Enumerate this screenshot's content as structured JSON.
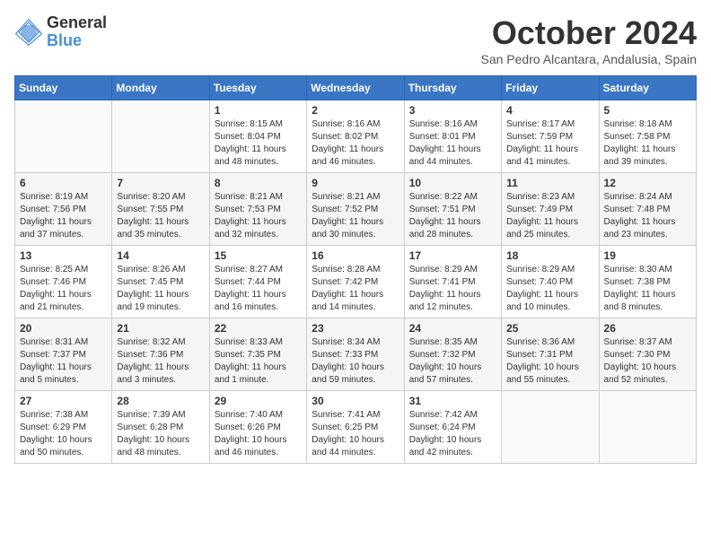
{
  "logo": {
    "general": "General",
    "blue": "Blue"
  },
  "header": {
    "month": "October 2024",
    "location": "San Pedro Alcantara, Andalusia, Spain"
  },
  "days_of_week": [
    "Sunday",
    "Monday",
    "Tuesday",
    "Wednesday",
    "Thursday",
    "Friday",
    "Saturday"
  ],
  "weeks": [
    [
      {
        "day": "",
        "info": ""
      },
      {
        "day": "",
        "info": ""
      },
      {
        "day": "1",
        "info": "Sunrise: 8:15 AM\nSunset: 8:04 PM\nDaylight: 11 hours and 48 minutes."
      },
      {
        "day": "2",
        "info": "Sunrise: 8:16 AM\nSunset: 8:02 PM\nDaylight: 11 hours and 46 minutes."
      },
      {
        "day": "3",
        "info": "Sunrise: 8:16 AM\nSunset: 8:01 PM\nDaylight: 11 hours and 44 minutes."
      },
      {
        "day": "4",
        "info": "Sunrise: 8:17 AM\nSunset: 7:59 PM\nDaylight: 11 hours and 41 minutes."
      },
      {
        "day": "5",
        "info": "Sunrise: 8:18 AM\nSunset: 7:58 PM\nDaylight: 11 hours and 39 minutes."
      }
    ],
    [
      {
        "day": "6",
        "info": "Sunrise: 8:19 AM\nSunset: 7:56 PM\nDaylight: 11 hours and 37 minutes."
      },
      {
        "day": "7",
        "info": "Sunrise: 8:20 AM\nSunset: 7:55 PM\nDaylight: 11 hours and 35 minutes."
      },
      {
        "day": "8",
        "info": "Sunrise: 8:21 AM\nSunset: 7:53 PM\nDaylight: 11 hours and 32 minutes."
      },
      {
        "day": "9",
        "info": "Sunrise: 8:21 AM\nSunset: 7:52 PM\nDaylight: 11 hours and 30 minutes."
      },
      {
        "day": "10",
        "info": "Sunrise: 8:22 AM\nSunset: 7:51 PM\nDaylight: 11 hours and 28 minutes."
      },
      {
        "day": "11",
        "info": "Sunrise: 8:23 AM\nSunset: 7:49 PM\nDaylight: 11 hours and 25 minutes."
      },
      {
        "day": "12",
        "info": "Sunrise: 8:24 AM\nSunset: 7:48 PM\nDaylight: 11 hours and 23 minutes."
      }
    ],
    [
      {
        "day": "13",
        "info": "Sunrise: 8:25 AM\nSunset: 7:46 PM\nDaylight: 11 hours and 21 minutes."
      },
      {
        "day": "14",
        "info": "Sunrise: 8:26 AM\nSunset: 7:45 PM\nDaylight: 11 hours and 19 minutes."
      },
      {
        "day": "15",
        "info": "Sunrise: 8:27 AM\nSunset: 7:44 PM\nDaylight: 11 hours and 16 minutes."
      },
      {
        "day": "16",
        "info": "Sunrise: 8:28 AM\nSunset: 7:42 PM\nDaylight: 11 hours and 14 minutes."
      },
      {
        "day": "17",
        "info": "Sunrise: 8:29 AM\nSunset: 7:41 PM\nDaylight: 11 hours and 12 minutes."
      },
      {
        "day": "18",
        "info": "Sunrise: 8:29 AM\nSunset: 7:40 PM\nDaylight: 11 hours and 10 minutes."
      },
      {
        "day": "19",
        "info": "Sunrise: 8:30 AM\nSunset: 7:38 PM\nDaylight: 11 hours and 8 minutes."
      }
    ],
    [
      {
        "day": "20",
        "info": "Sunrise: 8:31 AM\nSunset: 7:37 PM\nDaylight: 11 hours and 5 minutes."
      },
      {
        "day": "21",
        "info": "Sunrise: 8:32 AM\nSunset: 7:36 PM\nDaylight: 11 hours and 3 minutes."
      },
      {
        "day": "22",
        "info": "Sunrise: 8:33 AM\nSunset: 7:35 PM\nDaylight: 11 hours and 1 minute."
      },
      {
        "day": "23",
        "info": "Sunrise: 8:34 AM\nSunset: 7:33 PM\nDaylight: 10 hours and 59 minutes."
      },
      {
        "day": "24",
        "info": "Sunrise: 8:35 AM\nSunset: 7:32 PM\nDaylight: 10 hours and 57 minutes."
      },
      {
        "day": "25",
        "info": "Sunrise: 8:36 AM\nSunset: 7:31 PM\nDaylight: 10 hours and 55 minutes."
      },
      {
        "day": "26",
        "info": "Sunrise: 8:37 AM\nSunset: 7:30 PM\nDaylight: 10 hours and 52 minutes."
      }
    ],
    [
      {
        "day": "27",
        "info": "Sunrise: 7:38 AM\nSunset: 6:29 PM\nDaylight: 10 hours and 50 minutes."
      },
      {
        "day": "28",
        "info": "Sunrise: 7:39 AM\nSunset: 6:28 PM\nDaylight: 10 hours and 48 minutes."
      },
      {
        "day": "29",
        "info": "Sunrise: 7:40 AM\nSunset: 6:26 PM\nDaylight: 10 hours and 46 minutes."
      },
      {
        "day": "30",
        "info": "Sunrise: 7:41 AM\nSunset: 6:25 PM\nDaylight: 10 hours and 44 minutes."
      },
      {
        "day": "31",
        "info": "Sunrise: 7:42 AM\nSunset: 6:24 PM\nDaylight: 10 hours and 42 minutes."
      },
      {
        "day": "",
        "info": ""
      },
      {
        "day": "",
        "info": ""
      }
    ]
  ]
}
